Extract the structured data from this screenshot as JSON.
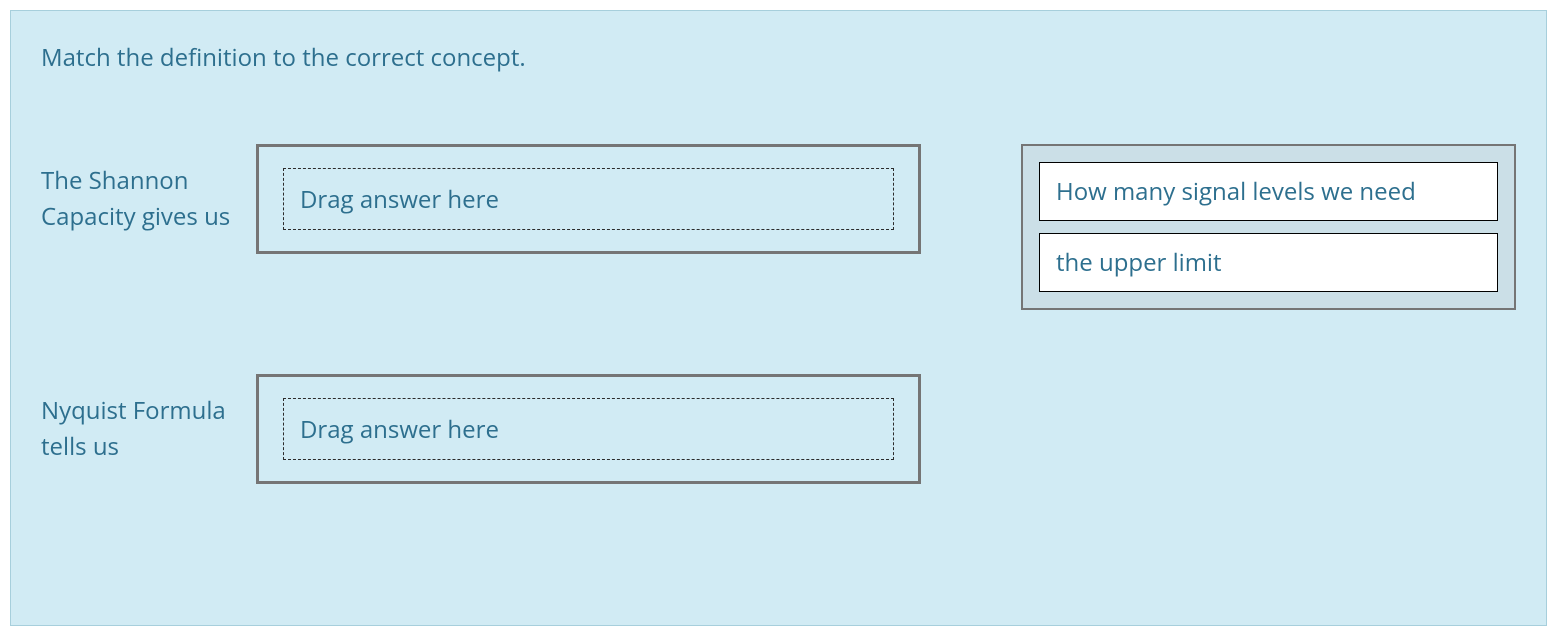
{
  "question": {
    "prompt": "Match the definition to the correct concept.",
    "rows": [
      {
        "label": "The Shannon Capacity gives us",
        "placeholder": "Drag answer here"
      },
      {
        "label": "Nyquist Formula tells us",
        "placeholder": "Drag answer here"
      }
    ],
    "answers": [
      {
        "text": "How many signal levels we need"
      },
      {
        "text": "the upper limit"
      }
    ]
  }
}
